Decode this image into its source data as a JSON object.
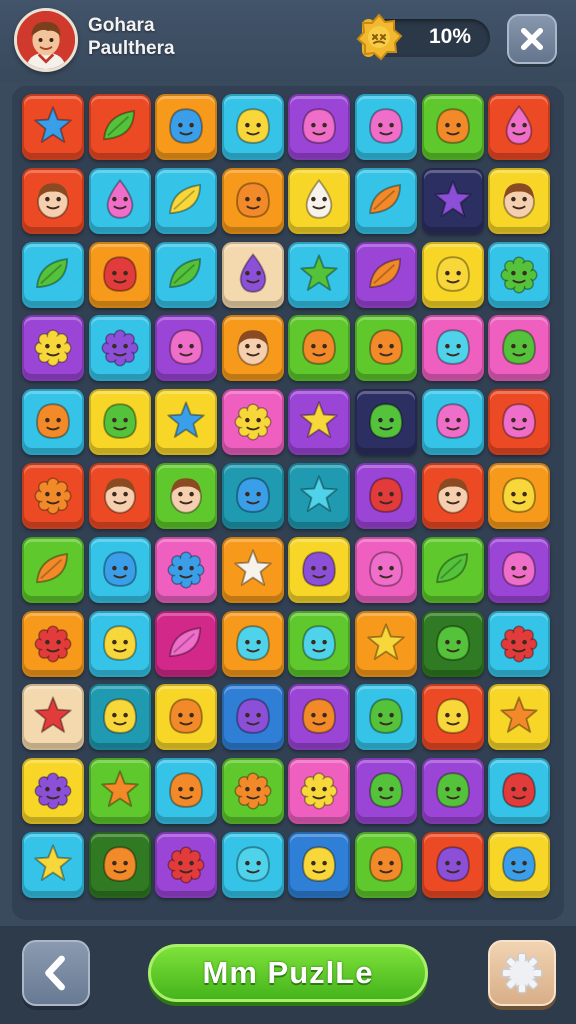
{
  "player": {
    "name_line1": "Gohara",
    "name_line2": "Paulthera",
    "avatar": "boy-avatar-icon"
  },
  "progress": {
    "label": "10%",
    "fraction": 0.1,
    "badge_icon": "star-badge-icon"
  },
  "header": {
    "close_icon": "close-icon"
  },
  "footer": {
    "back_icon": "chevron-left-icon",
    "title": "Mm PuzlLe",
    "settings_icon": "gear-icon"
  },
  "colors": {
    "background": "#3a4b5e",
    "accent_green": "#5ccc26",
    "progress_gold": "#e9b22a"
  },
  "board": {
    "rows": 11,
    "cols": 8,
    "tiles": [
      [
        "red:blue-star",
        "red:green-leaf",
        "orange:blue-blob",
        "cyan:yellow-blob",
        "purple:pink-blob",
        "cyan:pink-blob",
        "green:orange-blob",
        "red:pink-drop"
      ],
      [
        "red:face",
        "cyan:pink-drop",
        "cyan:yellow-leaf",
        "orange:orange-blob",
        "yellow:white-drop",
        "cyan:orange-leaf",
        "navy:purple-star",
        "yellow:red-face"
      ],
      [
        "cyan:green-leaf",
        "orange:red-blob",
        "cyan:green-leaf",
        "peach:purple-drop",
        "cyan:green-star",
        "purple:orange-leaf",
        "yellow:yellow-blob",
        "cyan:green-flower"
      ],
      [
        "purple:yellow-flower",
        "cyan:purple-flower",
        "purple:pink-blob",
        "orange:face",
        "green:orange-blob",
        "green:orange-blob",
        "pink:cyan-blob",
        "pink:green-blob"
      ],
      [
        "cyan:orange-blob",
        "yellow:green-blob",
        "yellow:blue-star",
        "pink:yellow-flower",
        "purple:yellow-star",
        "navy:green-blob",
        "cyan:pink-blob",
        "red:pink-blob"
      ],
      [
        "red:orange-flower",
        "red:face",
        "green:face",
        "teal:blue-blob",
        "teal:cyan-star",
        "purple:red-blob",
        "red:face",
        "orange:yellow-blob"
      ],
      [
        "green:orange-leaf",
        "cyan:blue-blob",
        "pink:blue-flower",
        "orange:white-star",
        "yellow:purple-blob",
        "pink:pink-blob",
        "green:green-leaf",
        "purple:pink-blob"
      ],
      [
        "orange:red-flower",
        "cyan:yellow-blob",
        "magenta:pink-leaf",
        "orange:cyan-blob",
        "green:cyan-blob",
        "orange:yellow-star",
        "darkgreen:green-blob",
        "cyan:red-flower"
      ],
      [
        "peach:red-star",
        "teal:yellow-blob",
        "yellow:orange-blob",
        "blue:purple-blob",
        "purple:orange-blob",
        "cyan:green-blob",
        "red:yellow-blob",
        "yellow:orange-star"
      ],
      [
        "yellow:purple-flower",
        "green:orange-star",
        "cyan:orange-blob",
        "green:orange-flower",
        "pink:yellow-flower",
        "purple:green-blob",
        "purple:green-blob",
        "cyan:red-blob"
      ],
      [
        "cyan:yellow-star",
        "darkgreen:orange-blob",
        "purple:red-flower",
        "cyan:cyan-blob",
        "blue:yellow-blob",
        "green:orange-blob",
        "red:purple-blob",
        "yellow:blue-blob"
      ]
    ]
  }
}
